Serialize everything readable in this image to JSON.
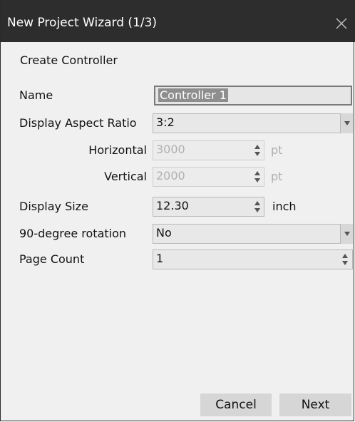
{
  "window": {
    "title": "New Project Wizard (1/3)",
    "heading": "Create Controller"
  },
  "form": {
    "name": {
      "label": "Name",
      "value": "Controller 1"
    },
    "aspect": {
      "label": "Display Aspect Ratio",
      "value": "3:2"
    },
    "horizontal": {
      "label": "Horizontal",
      "value": "3000",
      "unit": "pt"
    },
    "vertical": {
      "label": "Vertical",
      "value": "2000",
      "unit": "pt"
    },
    "display_size": {
      "label": "Display Size",
      "value": "12.30",
      "unit": "inch"
    },
    "rotation": {
      "label": "90-degree rotation",
      "value": "No"
    },
    "page_count": {
      "label": "Page Count",
      "value": "1"
    }
  },
  "buttons": {
    "cancel": "Cancel",
    "next": "Next"
  },
  "icons": {
    "close": "close-icon"
  },
  "colors": {
    "titlebar": "#2d2d2d",
    "background": "#f0f0f0",
    "field": "#e8e8e8",
    "button": "#d6d6d6",
    "selection": "#8e8e8e"
  }
}
